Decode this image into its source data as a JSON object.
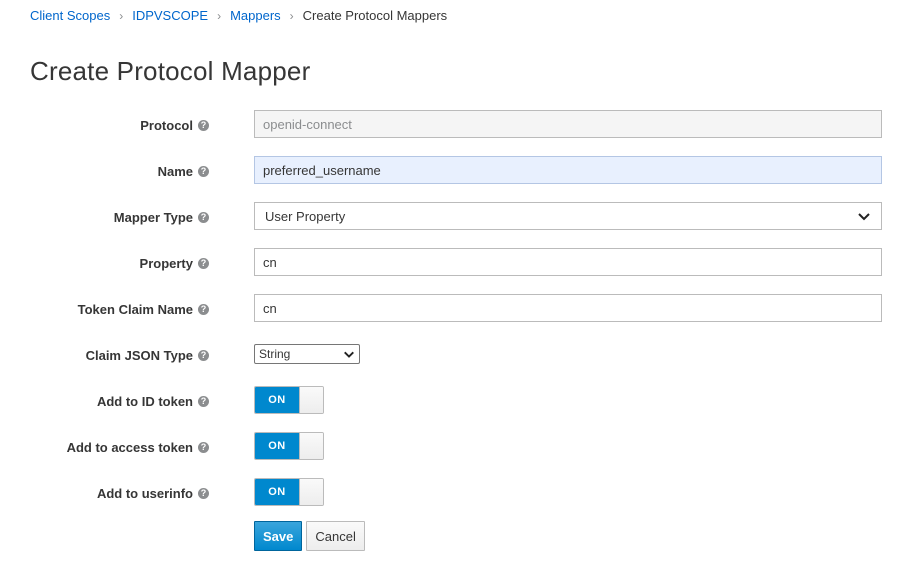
{
  "breadcrumb": {
    "items": [
      "Client Scopes",
      "IDPVSCOPE",
      "Mappers"
    ],
    "current": "Create Protocol Mappers"
  },
  "page": {
    "title": "Create Protocol Mapper"
  },
  "form": {
    "protocol": {
      "label": "Protocol",
      "value": "openid-connect"
    },
    "name": {
      "label": "Name",
      "value": "preferred_username"
    },
    "mapper_type": {
      "label": "Mapper Type",
      "value": "User Property"
    },
    "property": {
      "label": "Property",
      "value": "cn"
    },
    "token_claim_name": {
      "label": "Token Claim Name",
      "value": "cn"
    },
    "claim_json_type": {
      "label": "Claim JSON Type",
      "value": "String"
    },
    "add_to_id_token": {
      "label": "Add to ID token",
      "state": "ON"
    },
    "add_to_access_token": {
      "label": "Add to access token",
      "state": "ON"
    },
    "add_to_userinfo": {
      "label": "Add to userinfo",
      "state": "ON"
    }
  },
  "actions": {
    "save": "Save",
    "cancel": "Cancel"
  },
  "icons": {
    "help": "question-circle-icon",
    "separator": "chevron-right-icon",
    "dropdown": "chevron-down-icon"
  },
  "colors": {
    "link": "#0066cc",
    "primary": "#0088ce",
    "toggle_on": "#0088ce"
  }
}
